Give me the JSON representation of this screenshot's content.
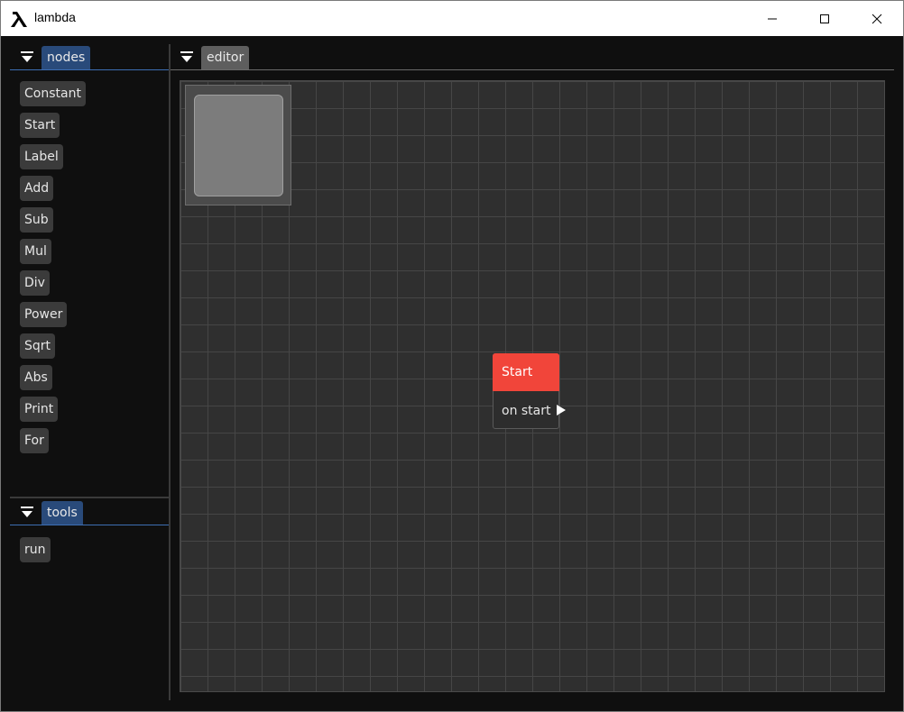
{
  "window": {
    "title": "lambda",
    "icon": "lambda-icon",
    "controls": [
      "minimize-icon",
      "maximize-icon",
      "close-icon"
    ]
  },
  "nodes_panel": {
    "tab_label": "nodes",
    "items": [
      "Constant",
      "Start",
      "Label",
      "Add",
      "Sub",
      "Mul",
      "Div",
      "Power",
      "Sqrt",
      "Abs",
      "Print",
      "For"
    ]
  },
  "tools_panel": {
    "tab_label": "tools",
    "items": [
      "run"
    ]
  },
  "editor_panel": {
    "tab_label": "editor",
    "node": {
      "title": "Start",
      "output_label": "on start",
      "header_color": "#f1453a"
    }
  },
  "colors": {
    "active_tab": "#294a7a",
    "inactive_tab": "#5e5e5e",
    "canvas": "#2f2f2f",
    "grid": "#464646"
  }
}
